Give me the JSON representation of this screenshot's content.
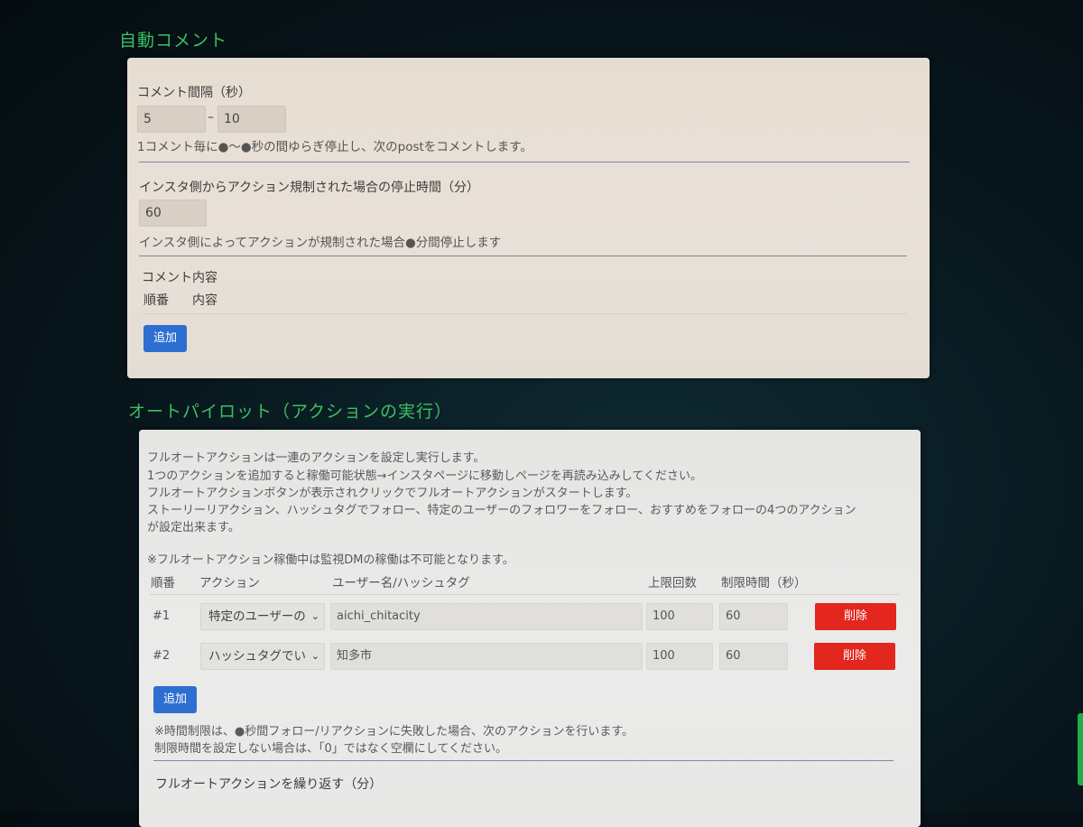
{
  "comment_section": {
    "title": "自動コメント",
    "interval_label": "コメント間隔（秒）",
    "interval_min": "5",
    "interval_sep": "–",
    "interval_max": "10",
    "interval_help": "1コメント毎に●～●秒の間ゆらぎ停止し、次のpostをコメントします。",
    "stop_label": "インスタ側からアクション規制された場合の停止時間（分）",
    "stop_value": "60",
    "stop_help": "インスタ側によってアクションが規制された場合●分間停止します",
    "content_label": "コメント内容",
    "col_order": "順番",
    "col_content": "内容",
    "add_button": "追加"
  },
  "autopilot_section": {
    "title": "オートパイロット（アクションの実行）",
    "description": [
      "フルオートアクションは一連のアクションを設定し実行します。",
      "1つのアクションを追加すると稼働可能状態→インスタページに移動しページを再読み込みしてください。",
      "フルオートアクションボタンが表示されクリックでフルオートアクションがスタートします。",
      "ストーリーリアクション、ハッシュタグでフォロー、特定のユーザーのフォロワーをフォロー、おすすめをフォローの4つのアクション",
      "が設定出来ます。"
    ],
    "note": "※フルオートアクション稼働中は監視DMの稼働は不可能となります。",
    "columns": {
      "order": "順番",
      "action": "アクション",
      "username": "ユーザー名/ハッシュタグ",
      "limit": "上限回数",
      "time_limit": "制限時間（秒）"
    },
    "rows": [
      {
        "num": "#1",
        "action": "特定のユーザーの",
        "username": "aichi_chitacity",
        "limit": "100",
        "time_limit": "60",
        "delete": "削除"
      },
      {
        "num": "#2",
        "action": "ハッシュタグでい",
        "username": "知多市",
        "limit": "100",
        "time_limit": "60",
        "delete": "削除"
      }
    ],
    "add_button": "追加",
    "footnote_1": "※時間制限は、●秒間フォロー/リアクションに失敗した場合、次のアクションを行います。",
    "footnote_2": "制限時間を設定しない場合は、「0」ではなく空欄にしてください。",
    "repeat_label": "フルオートアクションを繰り返す（分）"
  },
  "icons": {
    "select_arrow": "chevron-down-icon"
  },
  "colors": {
    "section_title": "#3bbf63",
    "primary_button": "#2d6fd0",
    "delete_button": "#e3261e"
  }
}
